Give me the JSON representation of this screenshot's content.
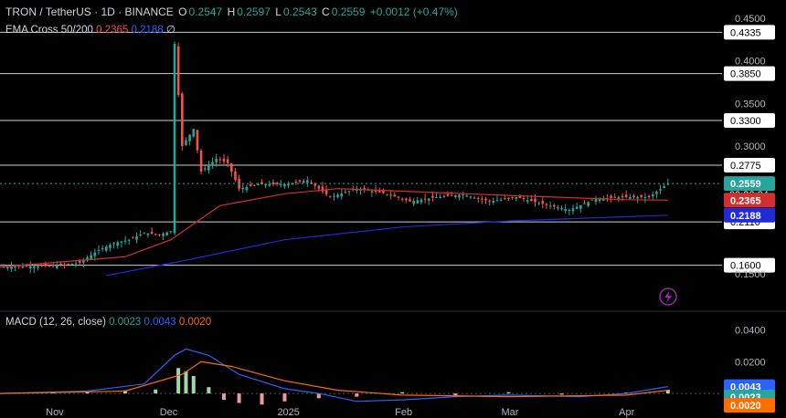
{
  "header": {
    "symbol": "TRON / TetherUS · 1D · BINANCE",
    "o_label": "O",
    "o_value": "0.2547",
    "h_label": "H",
    "h_value": "0.2597",
    "l_label": "L",
    "l_value": "0.2543",
    "c_label": "C",
    "c_value": "0.2559",
    "change": "+0.0012 (+0.47%)"
  },
  "indicator": {
    "name": "EMA Cross 50/200",
    "ema50": "0.2365",
    "ema200": "0.2188",
    "symbol": "∅"
  },
  "macd_header": {
    "name": "MACD (12, 26, close)",
    "hist": "0.0023",
    "macd": "0.0043",
    "signal": "0.0020"
  },
  "colors": {
    "up": "#26a69a",
    "down": "#ef5350",
    "ema50": "#d32f2f",
    "ema200": "#1e2bd6",
    "macd_line": "#2962ff",
    "signal_line": "#ff6d00",
    "hline": "#cfcfcf"
  },
  "icons": {
    "lightning": "lightning-icon"
  },
  "chart_data": [
    {
      "type": "candlestick",
      "pair": "TRX/USDT",
      "interval": "1D",
      "ylim": [
        0.12,
        0.45
      ],
      "y_ticks": [
        "0.4500",
        "0.4000",
        "0.3500",
        "0.3000",
        "0.1500"
      ],
      "x_ticks": [
        "Nov",
        "Dec",
        "2025",
        "Feb",
        "Mar",
        "Apr"
      ],
      "horizontal_levels": [
        0.4335,
        0.385,
        0.33,
        0.2775,
        0.211,
        0.16
      ],
      "horizontal_level_labels": [
        "0.4335",
        "0.3850",
        "0.3300",
        "0.2775",
        "0.2110",
        "0.1600"
      ],
      "last_price": 0.2559,
      "last_price_label": "0.2559",
      "countdown": "09:36:04",
      "ema50_label": "0.2365",
      "ema200_label": "0.2188",
      "close_path": [
        [
          "2024-10-18",
          0.158
        ],
        [
          "2024-10-25",
          0.159
        ],
        [
          "2024-11-01",
          0.159
        ],
        [
          "2024-11-08",
          0.163
        ],
        [
          "2024-11-13",
          0.178
        ],
        [
          "2024-11-17",
          0.186
        ],
        [
          "2024-11-21",
          0.19
        ],
        [
          "2024-11-25",
          0.198
        ],
        [
          "2024-11-29",
          0.196
        ],
        [
          "2024-12-02",
          0.2
        ],
        [
          "2024-12-03",
          0.42
        ],
        [
          "2024-12-05",
          0.3
        ],
        [
          "2024-12-08",
          0.32
        ],
        [
          "2024-12-10",
          0.27
        ],
        [
          "2024-12-14",
          0.285
        ],
        [
          "2024-12-17",
          0.28
        ],
        [
          "2024-12-20",
          0.25
        ],
        [
          "2024-12-25",
          0.255
        ],
        [
          "2025-01-01",
          0.255
        ],
        [
          "2025-01-07",
          0.26
        ],
        [
          "2025-01-13",
          0.24
        ],
        [
          "2025-01-20",
          0.25
        ],
        [
          "2025-01-27",
          0.245
        ],
        [
          "2025-02-03",
          0.235
        ],
        [
          "2025-02-10",
          0.24
        ],
        [
          "2025-02-17",
          0.243
        ],
        [
          "2025-02-24",
          0.235
        ],
        [
          "2025-03-03",
          0.24
        ],
        [
          "2025-03-10",
          0.232
        ],
        [
          "2025-03-17",
          0.225
        ],
        [
          "2025-03-24",
          0.238
        ],
        [
          "2025-03-31",
          0.24
        ],
        [
          "2025-04-07",
          0.24
        ],
        [
          "2025-04-12",
          0.2559
        ]
      ],
      "ema50": [
        [
          "2024-10-18",
          0.158
        ],
        [
          "2024-11-20",
          0.17
        ],
        [
          "2024-12-02",
          0.19
        ],
        [
          "2024-12-15",
          0.23
        ],
        [
          "2025-01-01",
          0.244
        ],
        [
          "2025-01-15",
          0.25
        ],
        [
          "2025-02-01",
          0.247
        ],
        [
          "2025-03-01",
          0.242
        ],
        [
          "2025-04-01",
          0.237
        ],
        [
          "2025-04-12",
          0.2365
        ]
      ],
      "ema200": [
        [
          "2024-11-15",
          0.148
        ],
        [
          "2024-12-05",
          0.165
        ],
        [
          "2025-01-01",
          0.19
        ],
        [
          "2025-02-01",
          0.205
        ],
        [
          "2025-03-01",
          0.212
        ],
        [
          "2025-04-12",
          0.2188
        ]
      ]
    },
    {
      "type": "macd",
      "params": "12, 26, close",
      "y_ticks": [
        "0.0400",
        "0.0200"
      ],
      "ylim": [
        -0.012,
        0.042
      ],
      "macd_label": "0.0043",
      "hist_label": "0.0023",
      "signal_label": "0.0020",
      "macd": [
        [
          "2024-10-18",
          0.0
        ],
        [
          "2024-11-10",
          0.0015
        ],
        [
          "2024-11-25",
          0.006
        ],
        [
          "2024-12-03",
          0.024
        ],
        [
          "2024-12-06",
          0.028
        ],
        [
          "2024-12-12",
          0.024
        ],
        [
          "2024-12-20",
          0.012
        ],
        [
          "2025-01-01",
          0.003
        ],
        [
          "2025-01-10",
          0.0
        ],
        [
          "2025-01-20",
          -0.005
        ],
        [
          "2025-02-01",
          -0.004
        ],
        [
          "2025-02-15",
          -0.002
        ],
        [
          "2025-03-01",
          -0.001
        ],
        [
          "2025-03-20",
          -0.002
        ],
        [
          "2025-04-01",
          0.0
        ],
        [
          "2025-04-12",
          0.0043
        ]
      ],
      "signal": [
        [
          "2024-10-18",
          0.0
        ],
        [
          "2024-11-20",
          0.0015
        ],
        [
          "2024-12-05",
          0.012
        ],
        [
          "2024-12-10",
          0.02
        ],
        [
          "2024-12-18",
          0.017
        ],
        [
          "2025-01-01",
          0.008
        ],
        [
          "2025-01-15",
          0.002
        ],
        [
          "2025-02-01",
          -0.001
        ],
        [
          "2025-03-01",
          -0.002
        ],
        [
          "2025-04-01",
          -0.001
        ],
        [
          "2025-04-12",
          0.002
        ]
      ],
      "histogram": [
        [
          "2024-11-01",
          0.0008
        ],
        [
          "2024-11-10",
          0.001
        ],
        [
          "2024-11-20",
          0.002
        ],
        [
          "2024-11-28",
          0.0025
        ],
        [
          "2024-12-04",
          0.016
        ],
        [
          "2024-12-06",
          0.014
        ],
        [
          "2024-12-08",
          0.011
        ],
        [
          "2024-12-12",
          0.004
        ],
        [
          "2024-12-16",
          -0.004
        ],
        [
          "2024-12-20",
          -0.006
        ],
        [
          "2024-12-26",
          -0.007
        ],
        [
          "2025-01-01",
          -0.005
        ],
        [
          "2025-01-10",
          -0.003
        ],
        [
          "2025-01-20",
          -0.002
        ],
        [
          "2025-02-01",
          0.0008
        ],
        [
          "2025-02-15",
          -0.0012
        ],
        [
          "2025-03-01",
          0.0008
        ],
        [
          "2025-03-15",
          -0.0008
        ],
        [
          "2025-04-01",
          0.0006
        ],
        [
          "2025-04-12",
          0.0023
        ]
      ]
    }
  ]
}
